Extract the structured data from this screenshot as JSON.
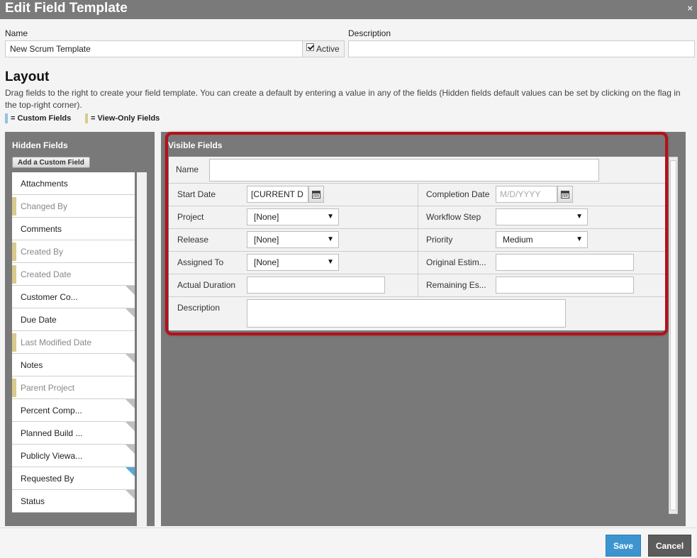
{
  "dialog": {
    "title": "Edit Field Template",
    "close_glyph": "×"
  },
  "template": {
    "name_label": "Name",
    "name_value": "New Scrum Template",
    "active_label": "Active",
    "active_checked": true,
    "description_label": "Description",
    "description_value": ""
  },
  "layout": {
    "heading": "Layout",
    "help_text": "Drag fields to the right to create your field template. You can create a default by entering a value in any of the fields (Hidden fields default values can be set by clicking on the flag in the top-right corner).",
    "legend": {
      "custom_label": "= Custom Fields",
      "custom_color": "#8fc3e0",
      "viewonly_label": "= View-Only Fields",
      "viewonly_color": "#d9ca8c"
    }
  },
  "hidden_fields": {
    "title": "Hidden Fields",
    "add_button": "Add a Custom Field",
    "items": [
      {
        "label": "Attachments",
        "view_only": false,
        "flag": "none"
      },
      {
        "label": "Changed By",
        "view_only": true,
        "flag": "none"
      },
      {
        "label": "Comments",
        "view_only": false,
        "flag": "none"
      },
      {
        "label": "Created By",
        "view_only": true,
        "flag": "none"
      },
      {
        "label": "Created Date",
        "view_only": true,
        "flag": "none"
      },
      {
        "label": "Customer Co...",
        "view_only": false,
        "flag": "default"
      },
      {
        "label": "Due Date",
        "view_only": false,
        "flag": "default"
      },
      {
        "label": "Last Modified Date",
        "view_only": true,
        "flag": "none"
      },
      {
        "label": "Notes",
        "view_only": false,
        "flag": "default"
      },
      {
        "label": "Parent Project",
        "view_only": true,
        "flag": "none"
      },
      {
        "label": "Percent Comp...",
        "view_only": false,
        "flag": "default"
      },
      {
        "label": "Planned Build ...",
        "view_only": false,
        "flag": "default"
      },
      {
        "label": "Publicly Viewa...",
        "view_only": false,
        "flag": "default"
      },
      {
        "label": "Requested By",
        "view_only": false,
        "flag": "custom"
      },
      {
        "label": "Status",
        "view_only": false,
        "flag": "default"
      }
    ]
  },
  "visible_fields": {
    "title": "Visible Fields",
    "name": {
      "label": "Name",
      "value": ""
    },
    "start_date": {
      "label": "Start Date",
      "value": "[CURRENT D"
    },
    "completion_date": {
      "label": "Completion Date",
      "placeholder": "M/D/YYYY"
    },
    "project": {
      "label": "Project",
      "value": "[None]"
    },
    "workflow_step": {
      "label": "Workflow Step",
      "value": ""
    },
    "release": {
      "label": "Release",
      "value": "[None]"
    },
    "priority": {
      "label": "Priority",
      "value": "Medium"
    },
    "assigned_to": {
      "label": "Assigned To",
      "value": "[None]"
    },
    "original_estimate": {
      "label": "Original Estim...",
      "value": ""
    },
    "actual_duration": {
      "label": "Actual Duration",
      "value": ""
    },
    "remaining_estimate": {
      "label": "Remaining Es...",
      "value": ""
    },
    "description": {
      "label": "Description",
      "value": ""
    }
  },
  "icons": {
    "dropdown_arrow": "▼",
    "calendar": "calendar-icon",
    "check": "check-icon"
  },
  "footer": {
    "save_label": "Save",
    "cancel_label": "Cancel"
  },
  "colors": {
    "highlight_border": "#b3101c",
    "save_button": "#3d95cf",
    "cancel_button": "#5c5c5c",
    "panel_bg": "#797979",
    "titlebar": "#7a7a7a"
  }
}
